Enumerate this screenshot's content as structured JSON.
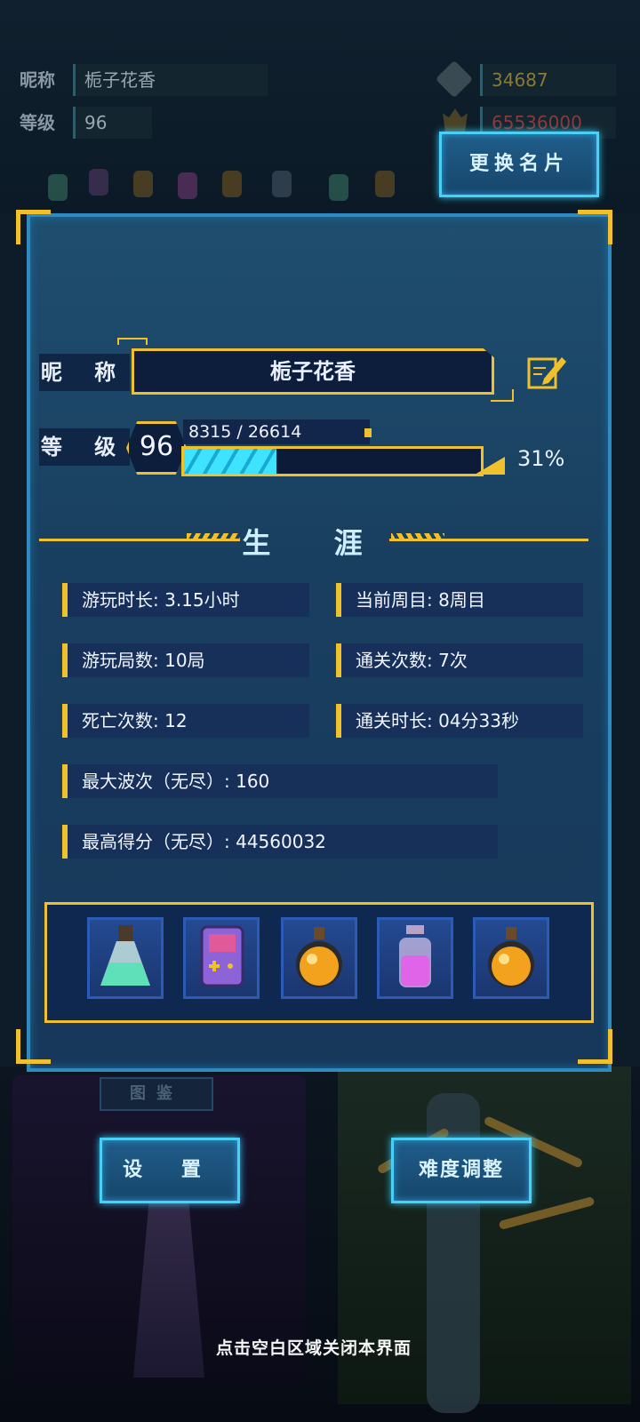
{
  "background": {
    "top_bar": {
      "nickname_label": "昵称",
      "nickname_value": "栀子花香",
      "level_label": "等级",
      "level_value": "96",
      "currency1": "34687",
      "currency2": "65536000"
    },
    "gallery_label": "图鉴"
  },
  "change_card_button": "更换名片",
  "profile": {
    "nickname_label": "昵 称",
    "nickname": "栀子花香",
    "level_label": "等 级",
    "level": "96",
    "xp_text": "8315 / 26614",
    "xp_progress": 0.31,
    "xp_percent": "31%"
  },
  "career": {
    "title": "生 涯",
    "stats": [
      {
        "text": "游玩时长: 3.15小时"
      },
      {
        "text": "当前周目: 8周目"
      },
      {
        "text": "游玩局数: 10局"
      },
      {
        "text": "通关次数: 7次"
      },
      {
        "text": "死亡次数: 12"
      },
      {
        "text": "通关时长: 04分33秒"
      },
      {
        "text": "最大波次（无尽）: 160"
      },
      {
        "text": "最高得分（无尽）: 44560032"
      }
    ]
  },
  "items": [
    {
      "icon": "green-flask-icon",
      "color": "#7ff0d0"
    },
    {
      "icon": "purple-gameboy-icon",
      "color": "#9b6fe0"
    },
    {
      "icon": "orange-potion-icon",
      "color": "#f2a21c"
    },
    {
      "icon": "pink-bottle-icon",
      "color": "#e064e8"
    },
    {
      "icon": "orange-potion-icon",
      "color": "#f2a21c"
    }
  ],
  "buttons": {
    "settings": "设 置",
    "difficulty": "难度调整"
  },
  "hint": "点击空白区域关闭本界面",
  "colors": {
    "accent_gold": "#f1c12c",
    "accent_cyan": "#4ad0f6",
    "panel_blue": "#1f4e6f"
  }
}
